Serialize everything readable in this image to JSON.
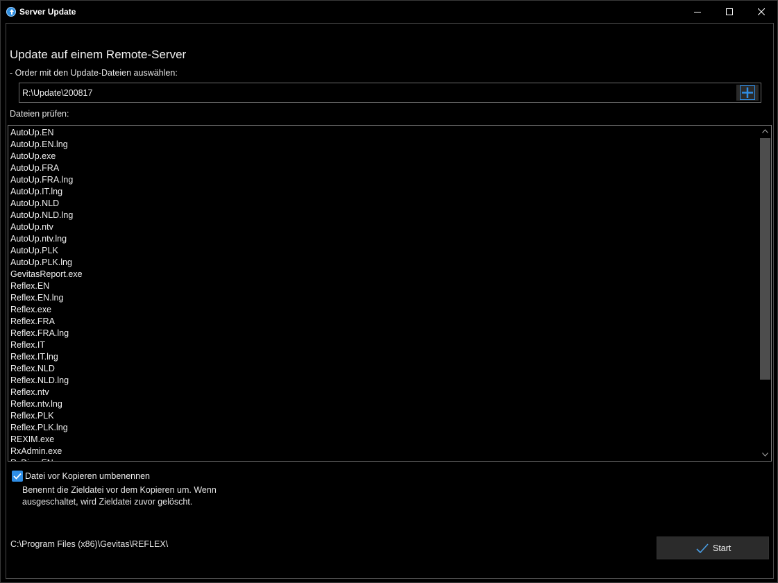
{
  "window": {
    "title": "Server Update",
    "accent_color": "#2f8ee6"
  },
  "main": {
    "heading": "Update auf einem Remote-Server",
    "folder_label": "- Order mit den Update-Dateien auswählen:",
    "folder_value": "R:\\Update\\200817",
    "check_files_label": "Dateien prüfen:",
    "files": [
      "AutoUp.EN",
      "AutoUp.EN.lng",
      "AutoUp.exe",
      "AutoUp.FRA",
      "AutoUp.FRA.lng",
      "AutoUp.IT.lng",
      "AutoUp.NLD",
      "AutoUp.NLD.lng",
      "AutoUp.ntv",
      "AutoUp.ntv.lng",
      "AutoUp.PLK",
      "AutoUp.PLK.lng",
      "GevitasReport.exe",
      "Reflex.EN",
      "Reflex.EN.lng",
      "Reflex.exe",
      "Reflex.FRA",
      "Reflex.FRA.lng",
      "Reflex.IT",
      "Reflex.IT.lng",
      "Reflex.NLD",
      "Reflex.NLD.lng",
      "Reflex.ntv",
      "Reflex.ntv.lng",
      "Reflex.PLK",
      "Reflex.PLK.lng",
      "REXIM.exe",
      "RxAdmin.exe",
      "RxDiag.EN"
    ],
    "rename_option": {
      "checked": true,
      "label": "Datei vor Kopieren umbenennen",
      "description": "Benennt die Zieldatei vor dem Kopieren um. Wenn ausgeschaltet, wird Zieldatei zuvor gelöscht."
    },
    "target_path": "C:\\Program Files (x86)\\Gevitas\\REFLEX\\",
    "start_label": "Start"
  },
  "icons": {
    "app": "upload-circle-icon",
    "add_folder": "plus-icon",
    "start": "checkmark-icon"
  }
}
